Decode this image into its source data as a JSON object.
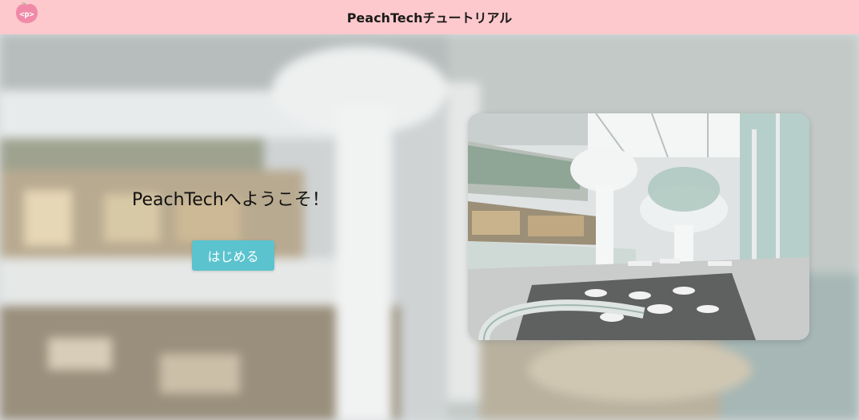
{
  "header": {
    "title": "PeachTechチュートリアル",
    "logo_text": "<p>"
  },
  "main": {
    "welcome_text": "PeachTechへようこそ！",
    "start_button": "はじめる"
  },
  "colors": {
    "header_bg": "#fdc9cc",
    "button_bg": "#5bc3ce",
    "logo_pink": "#f08aa8"
  }
}
